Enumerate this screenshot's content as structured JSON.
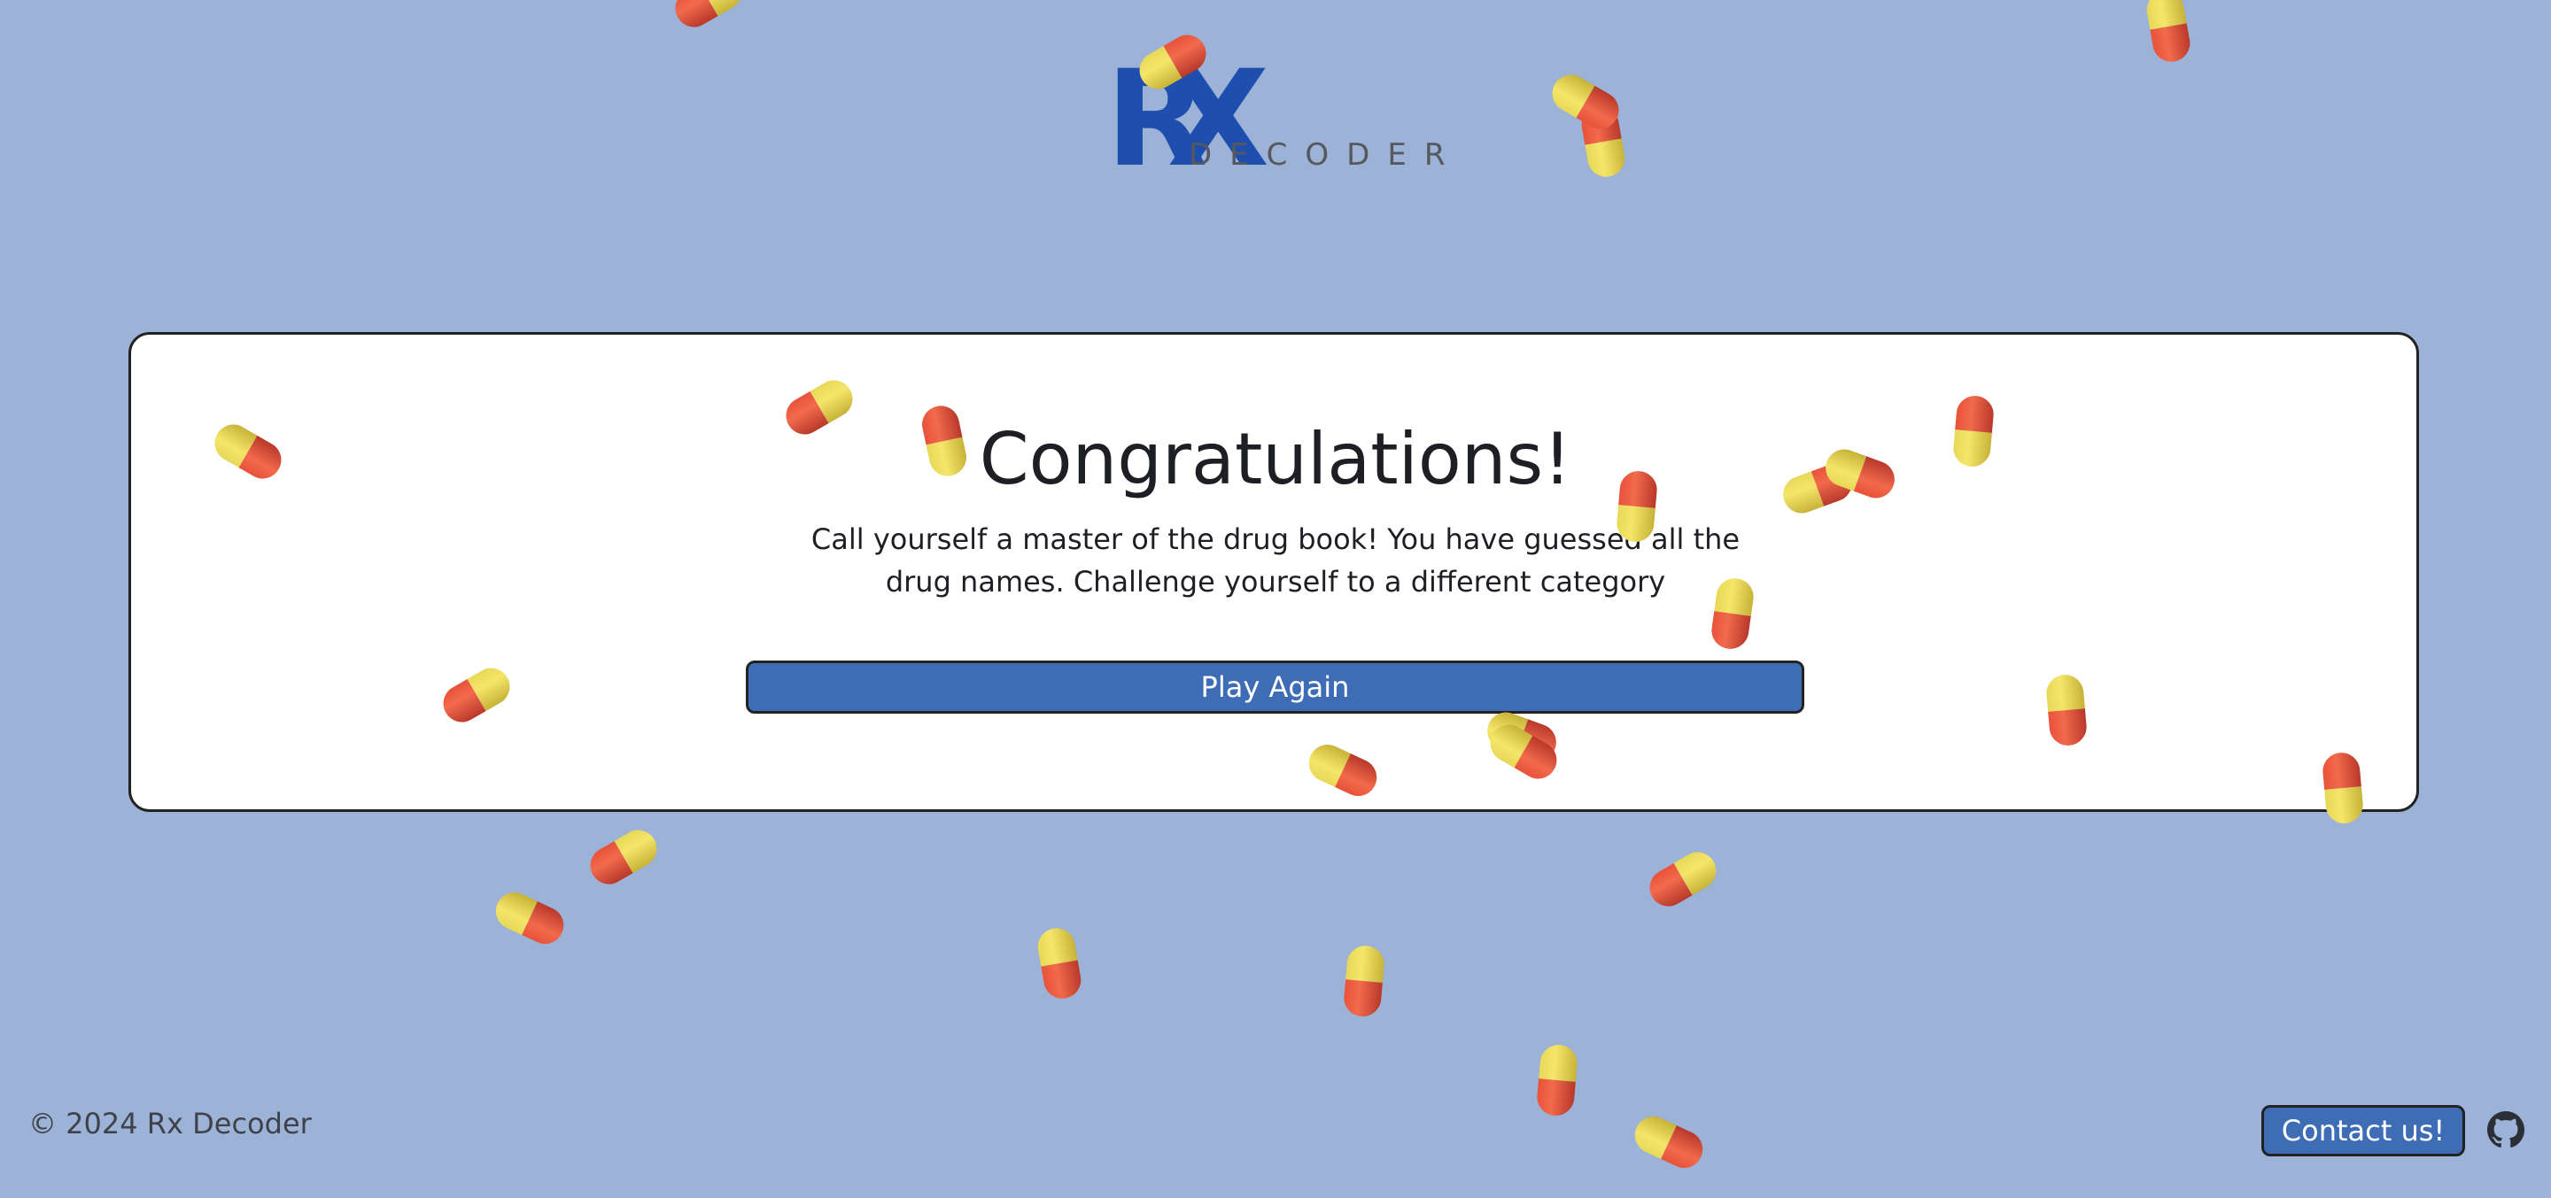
{
  "header": {
    "logo_rx": "RX",
    "logo_word": "DECODER"
  },
  "result": {
    "title": "Congratulations!",
    "message": "Call yourself a master of the drug book! You have guessed all the drug names. Challenge yourself to a different category",
    "play_again_label": "Play Again"
  },
  "footer": {
    "copyright": "© 2024 Rx Decoder",
    "contact_label": "Contact us!",
    "github_icon": "github-icon"
  },
  "colors": {
    "background": "#9cb3d7",
    "brand_blue": "#1f4fae",
    "button_blue": "#3e6db5",
    "pill_yellow": "#f4e66a",
    "pill_red": "#f26a4c"
  },
  "decorations": {
    "icon": "capsule-pill-icon"
  }
}
